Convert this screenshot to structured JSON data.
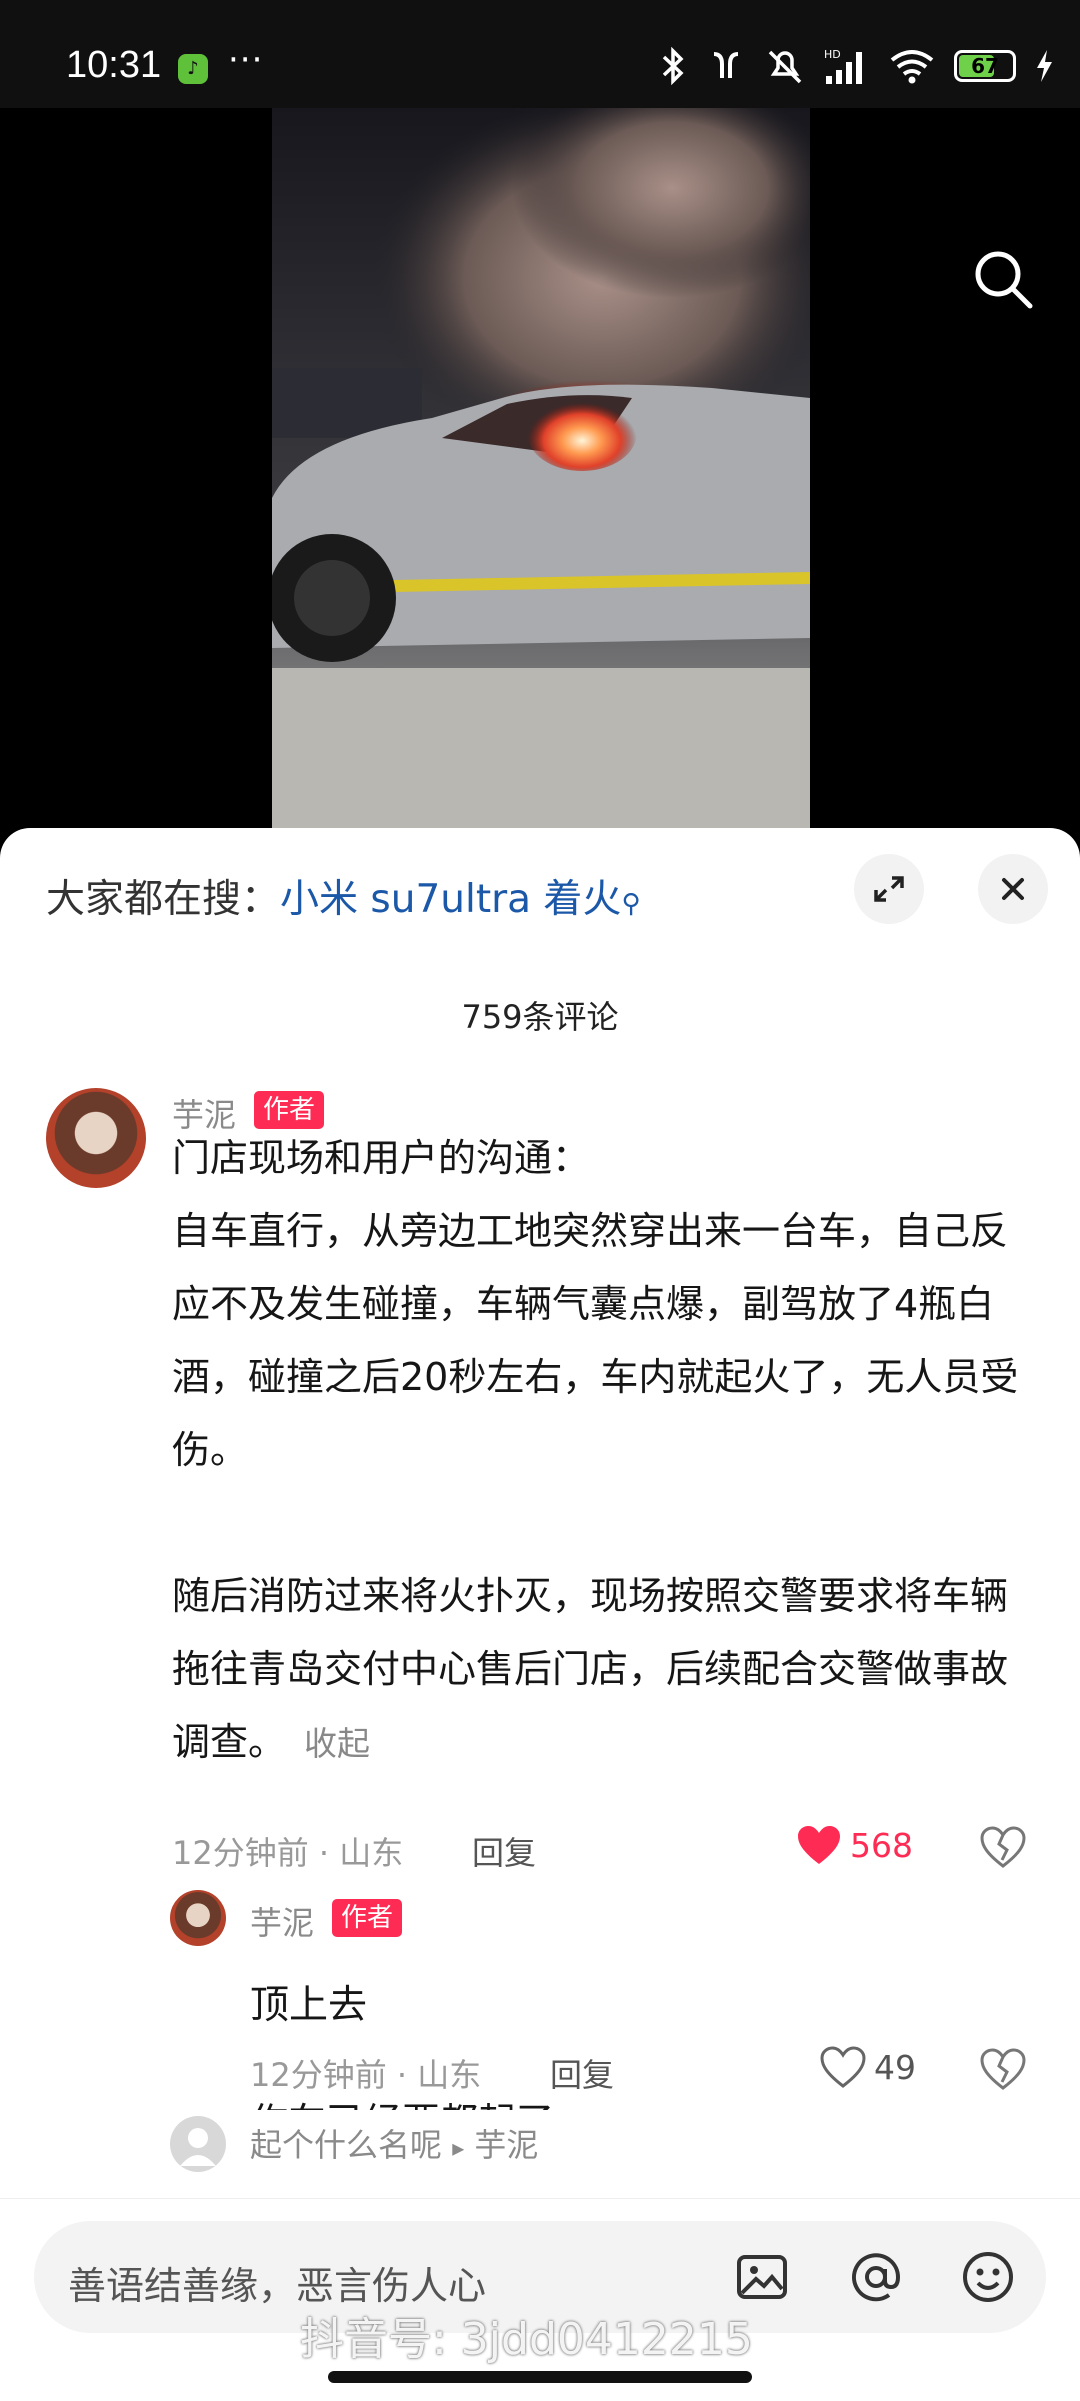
{
  "status": {
    "time": "10:31",
    "more": "···",
    "battery": "67",
    "battery_level": 0.67
  },
  "sheet": {
    "trending_prefix": "大家都在搜：",
    "trending_keyword": "小米 su7ultra 着火",
    "comment_count": "759条评论"
  },
  "comment": {
    "author": "芋泥",
    "author_tag": "作者",
    "paragraphs": [
      "门店现场和用户的沟通：",
      "自车直行，从旁边工地突然穿出来一台车，自己反应不及发生碰撞，车辆气囊点爆，副驾放了4瓶白酒，碰撞之后20秒左右，车内就起火了，无人员受伤。",
      "随后消防过来将火扑灭，现场按照交警要求将车辆拖往青岛交付中心售后门店，后续配合交警做事故调查。"
    ],
    "collapse": "收起",
    "time": "12分钟前",
    "location": "山东",
    "reply": "回复",
    "likes": "568"
  },
  "reply1": {
    "author": "芋泥",
    "author_tag": "作者",
    "text": "顶上去",
    "time": "12分钟前",
    "location": "山东",
    "reply": "回复",
    "likes": "49"
  },
  "reply2": {
    "author": "起个什么名呢",
    "arrow": "▸",
    "target": "芋泥",
    "partial": "作车已经要都起了"
  },
  "input": {
    "placeholder": "善语结善缘，恶言伤人心"
  },
  "watermark": "抖音号: 3jdd0412215",
  "colors": {
    "accent": "#fe2c55",
    "link": "#1c58a8"
  }
}
